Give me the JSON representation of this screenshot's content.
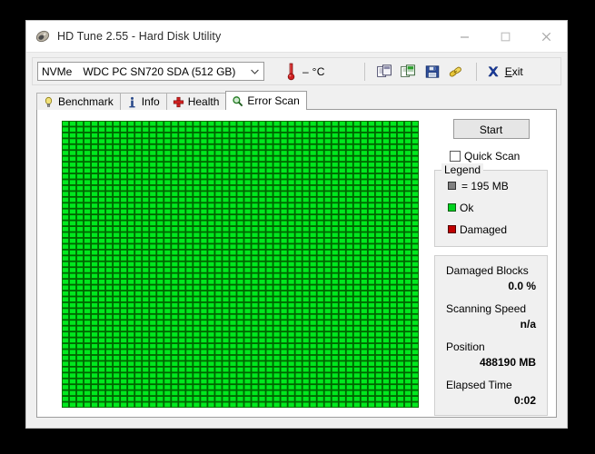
{
  "window": {
    "title": "HD Tune 2.55 - Hard Disk Utility",
    "app_icon": "hdtune-disk-icon",
    "controls": {
      "minimize": "minimize-icon",
      "maximize": "maximize-icon",
      "close": "close-icon"
    }
  },
  "toolbar": {
    "drive": {
      "interface": "NVMe",
      "model": "WDC PC SN720 SDA (512 GB)"
    },
    "temperature": "– °C",
    "icons": [
      {
        "name": "copy-icon"
      },
      {
        "name": "copy-color-icon"
      },
      {
        "name": "save-icon"
      },
      {
        "name": "link-icon"
      }
    ],
    "exit_label_prefix": "E",
    "exit_label_rest": "xit"
  },
  "tabs": [
    {
      "label": "Benchmark",
      "icon": "lightbulb-icon",
      "active": false
    },
    {
      "label": "Info",
      "icon": "info-icon",
      "active": false
    },
    {
      "label": "Health",
      "icon": "health-cross-icon",
      "active": false
    },
    {
      "label": "Error Scan",
      "icon": "magnifier-icon",
      "active": true
    }
  ],
  "error_scan": {
    "start_button": "Start",
    "quick_scan_label": "Quick Scan",
    "quick_scan_checked": false,
    "legend": {
      "title": "Legend",
      "items": [
        {
          "swatch": "block",
          "label": "= 195 MB"
        },
        {
          "swatch": "ok",
          "label": "Ok"
        },
        {
          "swatch": "dmg",
          "label": "Damaged"
        }
      ]
    },
    "stats": [
      {
        "key": "Damaged Blocks",
        "value": "0.0 %"
      },
      {
        "key": "Scanning Speed",
        "value": "n/a"
      },
      {
        "key": "Position",
        "value": "488190 MB"
      },
      {
        "key": "Elapsed Time",
        "value": "0:02"
      }
    ],
    "grid": {
      "columns": 49,
      "rows": 49,
      "cell_color": "#00e81e",
      "line_color": "#006400",
      "status": "all-ok"
    }
  }
}
